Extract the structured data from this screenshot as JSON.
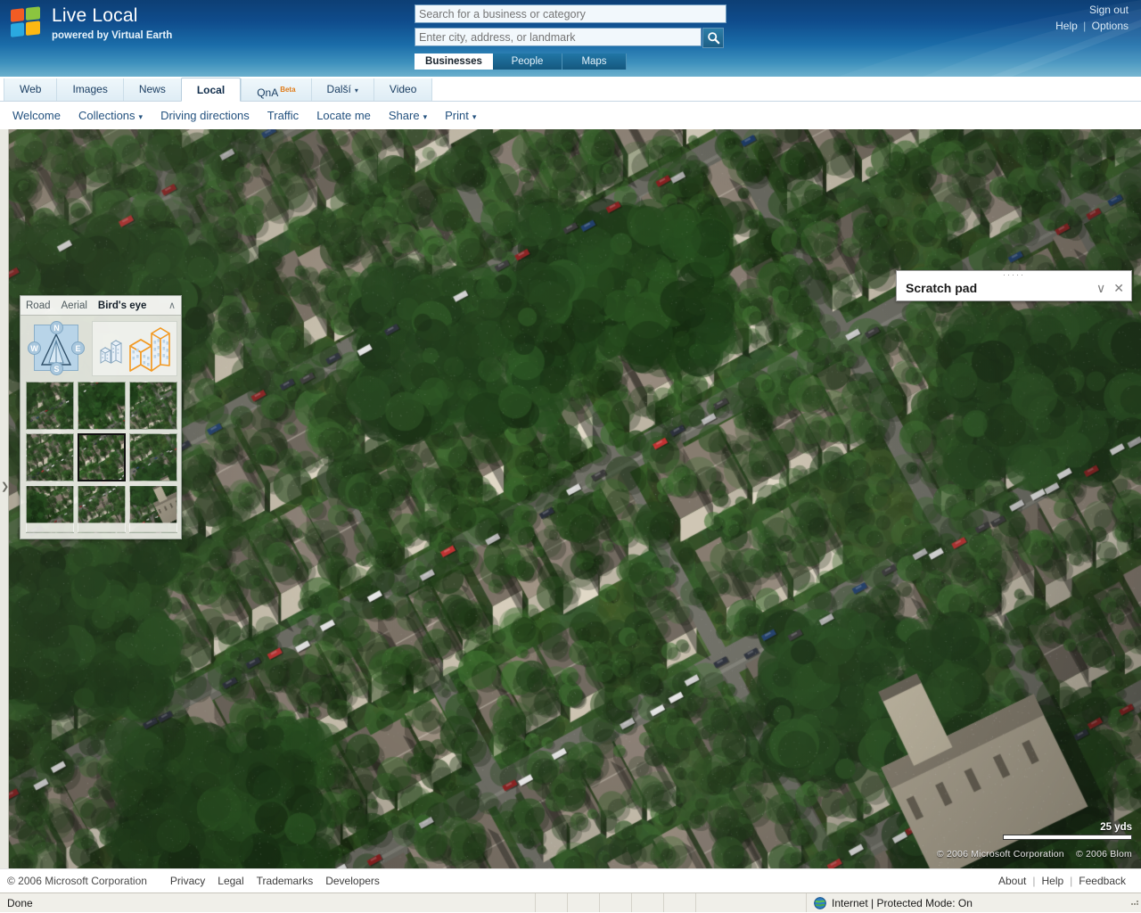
{
  "header": {
    "brand_title": "Live Local",
    "brand_subtitle": "powered by Virtual Earth",
    "logo_icon": "windows-flag-icon",
    "account": {
      "signout": "Sign out",
      "help": "Help",
      "separator": "|",
      "options": "Options"
    },
    "search": {
      "what_placeholder": "Search for a business or category",
      "what_value": "",
      "where_placeholder": "Enter city, address, or landmark",
      "where_value": "",
      "go_icon": "magnifier-icon",
      "scopes": [
        {
          "label": "Businesses",
          "selected": true
        },
        {
          "label": "People",
          "selected": false
        },
        {
          "label": "Maps",
          "selected": false
        }
      ]
    }
  },
  "service_tabs": [
    {
      "label": "Web",
      "selected": false
    },
    {
      "label": "Images",
      "selected": false
    },
    {
      "label": "News",
      "selected": false
    },
    {
      "label": "Local",
      "selected": true
    },
    {
      "label": "QnA",
      "badge": "Beta",
      "selected": false
    },
    {
      "label": "Další",
      "caret": "▾",
      "selected": false
    },
    {
      "label": "Video",
      "selected": false
    }
  ],
  "command_bar": [
    {
      "label": "Welcome"
    },
    {
      "label": "Collections",
      "caret": "▾"
    },
    {
      "label": "Driving directions"
    },
    {
      "label": "Traffic"
    },
    {
      "label": "Locate me"
    },
    {
      "label": "Share",
      "caret": "▾"
    },
    {
      "label": "Print",
      "caret": "▾"
    }
  ],
  "map": {
    "left_strip_icon": "chevron-right-icon",
    "left_strip_glyph": "❯",
    "mapmode": {
      "modes": [
        {
          "label": "Road",
          "selected": false
        },
        {
          "label": "Aerial",
          "selected": false
        },
        {
          "label": "Bird's eye",
          "selected": true
        }
      ],
      "collapse_icon": "chevron-up-icon",
      "collapse_glyph": "∧",
      "compass": {
        "north": "N",
        "east": "E",
        "south": "S",
        "west": "W"
      },
      "zoom_icons": [
        {
          "name": "buildings-small-icon",
          "selected": false
        },
        {
          "name": "buildings-large-icon",
          "selected": true
        }
      ],
      "thumbnails": [
        {
          "index": 0,
          "selected": false
        },
        {
          "index": 1,
          "selected": false
        },
        {
          "index": 2,
          "selected": false
        },
        {
          "index": 3,
          "selected": false
        },
        {
          "index": 4,
          "selected": true
        },
        {
          "index": 5,
          "selected": false
        },
        {
          "index": 6,
          "selected": false
        },
        {
          "index": 7,
          "selected": false
        },
        {
          "index": 8,
          "selected": false
        }
      ]
    },
    "scratchpad": {
      "grip_icon": "drag-dots-icon",
      "grip_glyph": "·····",
      "title": "Scratch pad",
      "minimize_icon": "chevron-down-icon",
      "minimize_glyph": "∨",
      "close_icon": "close-icon",
      "close_glyph": "✕"
    },
    "scale_label": "25 yds",
    "copyright_primary": "© 2006 Microsoft Corporation",
    "copyright_secondary": "© 2006 Blom"
  },
  "footer": {
    "copyright": "© 2006 Microsoft Corporation",
    "links": [
      "Privacy",
      "Legal",
      "Trademarks",
      "Developers"
    ],
    "right_links": [
      "About",
      "Help",
      "Feedback"
    ],
    "separator": "|"
  },
  "statusbar": {
    "status_text": "Done",
    "zone_icon": "internet-globe-icon",
    "zone_text": "Internet | Protected Mode: On"
  },
  "colors": {
    "header_top": "#0d3f75",
    "header_bottom": "#6cb0cd",
    "accent_link": "#24527f",
    "beta_badge": "#e07b18",
    "selected_tab_bg": "#ffffff"
  }
}
